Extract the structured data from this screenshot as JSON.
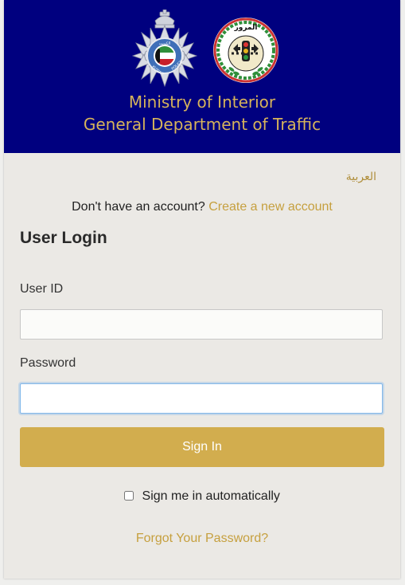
{
  "header": {
    "title_line1": "Ministry of Interior",
    "title_line2": "General Department of Traffic",
    "background_color": "#00007f",
    "title_color": "#d6b35b",
    "police_logo_icon": "kuwait-police-star-badge",
    "police_logo_text": "KUWAIT POLICE",
    "traffic_logo_icon": "traffic-department-emblem",
    "traffic_logo_text": "المرور"
  },
  "language_link": "العربية",
  "signup": {
    "prompt": "Don't have an account?",
    "link_label": "Create a new account"
  },
  "login": {
    "heading": "User Login",
    "user_id_label": "User ID",
    "user_id_value": "",
    "password_label": "Password",
    "password_value": "",
    "sign_in_label": "Sign In",
    "remember_label": "Sign me in automatically",
    "remember_checked": false,
    "forgot_label": "Forgot Your Password?"
  },
  "colors": {
    "accent_gold": "#d2ad4e",
    "link_gold": "#c6a03f",
    "card_background": "#ebe9e5"
  }
}
